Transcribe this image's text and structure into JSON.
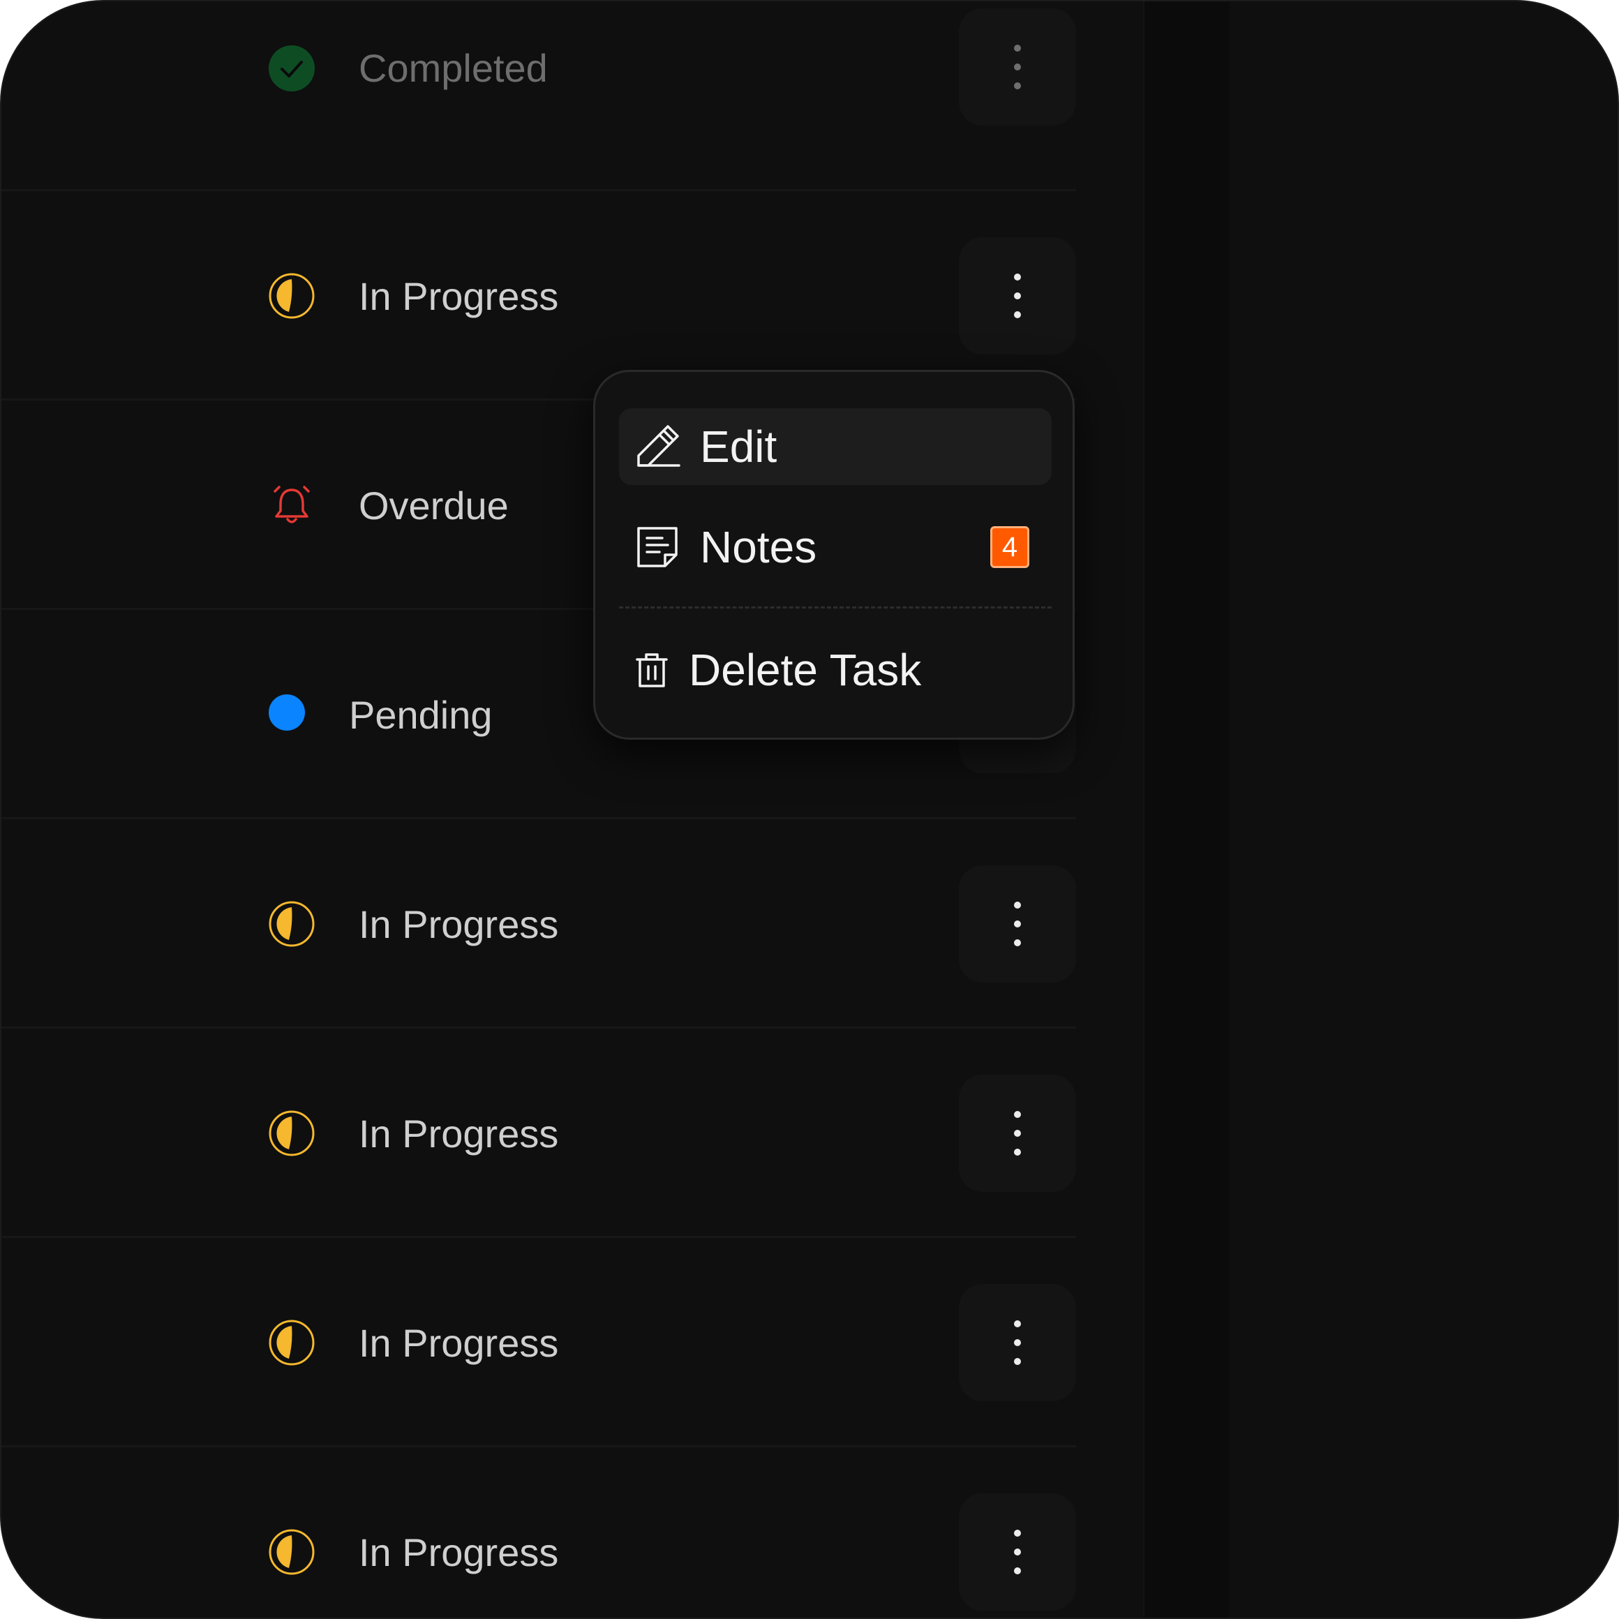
{
  "colors": {
    "completed": "#0e4d24",
    "in_progress": "#f5b82e",
    "overdue": "#e53935",
    "pending": "#0a84ff",
    "badge": "#ff5a00"
  },
  "rows": [
    {
      "status": "Completed",
      "icon": "check-circle-icon"
    },
    {
      "status": "In Progress",
      "icon": "half-circle-icon"
    },
    {
      "status": "Overdue",
      "icon": "alarm-bell-icon"
    },
    {
      "status": "Pending",
      "icon": "blue-dot-icon"
    },
    {
      "status": "In Progress",
      "icon": "half-circle-icon"
    },
    {
      "status": "In Progress",
      "icon": "half-circle-icon"
    },
    {
      "status": "In Progress",
      "icon": "half-circle-icon"
    },
    {
      "status": "In Progress",
      "icon": "half-circle-icon"
    }
  ],
  "menu": {
    "edit_label": "Edit",
    "notes_label": "Notes",
    "notes_count": "4",
    "delete_label": "Delete Task",
    "icons": [
      "pencil-icon",
      "note-icon",
      "trash-icon"
    ]
  }
}
